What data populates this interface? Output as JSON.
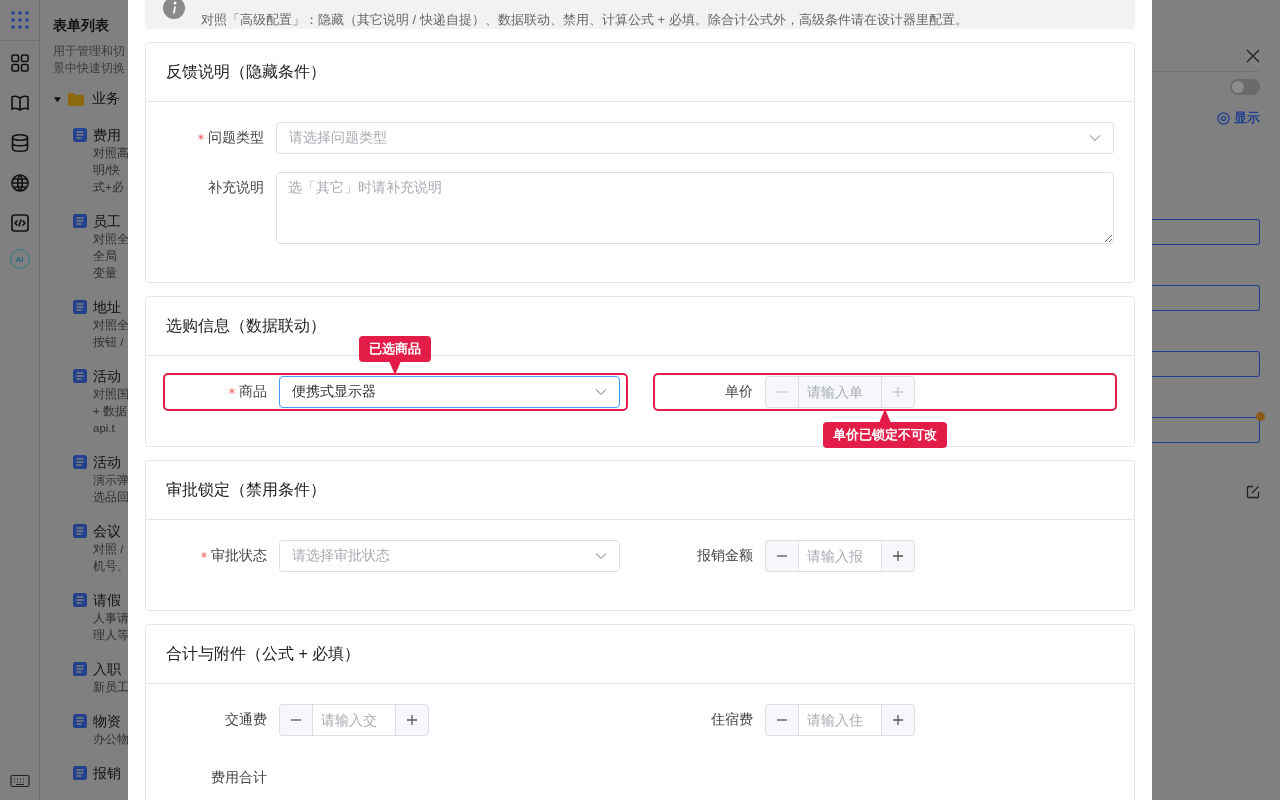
{
  "rail": {
    "ai_label": "AI"
  },
  "sidebar": {
    "title": "表单列表",
    "description_lines": [
      "用于管理和切",
      "景中快速切换"
    ],
    "folder": {
      "label": "业务",
      "expanded": true,
      "children": [
        {
          "title": "费用",
          "lines": [
            "对照高",
            "明/快",
            "式+必"
          ]
        },
        {
          "title": "员工",
          "lines": [
            "对照全",
            "全局",
            "变量"
          ]
        },
        {
          "title": "地址",
          "lines": [
            "对照全",
            "按钮 /"
          ]
        },
        {
          "title": "活动",
          "lines": [
            "对照国",
            "+ 数据",
            "api.t"
          ]
        },
        {
          "title": "活动",
          "lines": [
            "演示弹",
            "选品回"
          ]
        },
        {
          "title": "会议",
          "lines": [
            "对照 /",
            "机号、"
          ]
        },
        {
          "title": "请假",
          "lines": [
            "人事请",
            "理人等"
          ]
        },
        {
          "title": "入职",
          "lines": [
            "新员工"
          ]
        },
        {
          "title": "物资",
          "lines": [
            "办公物"
          ]
        },
        {
          "title": "报销"
        }
      ]
    }
  },
  "modal": {
    "notice": {
      "text": "对照「高级配置」：隐藏（其它说明 / 快递自提）、数据联动、禁用、计算公式 + 必填。除合计公式外，高级条件请在设计器里配置。"
    },
    "sections": [
      {
        "title": "反馈说明（隐藏条件）",
        "fields": [
          {
            "kind": "select",
            "label": "问题类型",
            "required": true,
            "placeholder": "请选择问题类型",
            "focused": false,
            "highlight": false,
            "full_width": true
          },
          {
            "kind": "textarea",
            "label": "补充说明",
            "required": false,
            "placeholder": "选「其它」时请补充说明",
            "highlight": false,
            "full_width": true
          }
        ]
      },
      {
        "title": "选购信息（数据联动）",
        "fields": [
          {
            "kind": "select",
            "label": "商品",
            "required": true,
            "value": "便携式显示器",
            "focused": true,
            "highlight": true,
            "callout": {
              "text": "已选商品",
              "below": false
            }
          },
          {
            "kind": "number",
            "label": "单价",
            "required": false,
            "placeholder": "请输入单",
            "disabled": true,
            "highlight": true,
            "callout": {
              "text": "单价已锁定不可改",
              "below": true
            }
          }
        ]
      },
      {
        "title": "审批锁定（禁用条件）",
        "fields": [
          {
            "kind": "select",
            "label": "审批状态",
            "required": true,
            "placeholder": "请选择审批状态",
            "focused": false,
            "highlight": false
          },
          {
            "kind": "number",
            "label": "报销金额",
            "required": false,
            "placeholder": "请输入报",
            "disabled": false,
            "highlight": false
          }
        ]
      },
      {
        "title": "合计与附件（公式 + 必填）",
        "fields": [
          {
            "kind": "number",
            "label": "交通费",
            "required": false,
            "placeholder": "请输入交",
            "disabled": false,
            "highlight": false
          },
          {
            "kind": "number",
            "label": "住宿费",
            "required": false,
            "placeholder": "请输入住",
            "disabled": false,
            "highlight": false
          },
          {
            "kind": "text",
            "label": "费用合计",
            "required": false,
            "highlight": false
          }
        ]
      }
    ]
  },
  "right_panel": {
    "toggle": {
      "on": false
    },
    "show_link": "显示",
    "outline_buttons": [
      {
        "badge": false
      },
      {
        "badge": false
      },
      {
        "badge": false
      },
      {
        "badge": true
      }
    ]
  }
}
